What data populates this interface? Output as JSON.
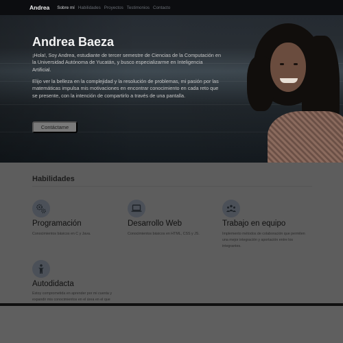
{
  "navbar": {
    "brand": "Andrea",
    "links": [
      "Sobre mí",
      "Habilidades",
      "Proyectos",
      "Testimonios",
      "Contacto"
    ]
  },
  "hero": {
    "title": "Andrea Baeza",
    "paragraph1": "¡Hola!, Soy Andrea, estudiante de tercer semestre de Ciencias de la Computación en la Universidad Autónoma de Yucatán, y busco especializarme en Inteligencia Artificial.",
    "paragraph2": "Elijo ver la belleza en la complejidad y la resolución de problemas, mi pasión por las matemáticas impulsa mis motivaciones en encontrar conocimiento en cada reto que se presente, con la intención de compartirlo a través de una pantalla.",
    "button": "Contáctame"
  },
  "skills": {
    "title": "Habilidades",
    "items": [
      {
        "name": "Programación",
        "description": "Conocimientos básicos en C y Java.",
        "icon": "gears-icon"
      },
      {
        "name": "Desarrollo Web",
        "description": "Conocimientos básicos en HTML, CSS y JS.",
        "icon": "laptop-icon"
      },
      {
        "name": "Trabajo en equipo",
        "description": "Implemento métodos de colaboración que permiten una mejor integración y aportación entre los integrantes.",
        "icon": "people-icon"
      },
      {
        "name": "Autodidacta",
        "description": "Estoy comprometida en aprender por mi cuenta y expandir mis conocimientos en el área en el que estoy enfocada.",
        "icon": "person-icon"
      }
    ]
  },
  "colors": {
    "navbar_bg": "#0c0d10",
    "overlay_gray": "#5d5d5d",
    "icon_circle": "#4b5058"
  }
}
